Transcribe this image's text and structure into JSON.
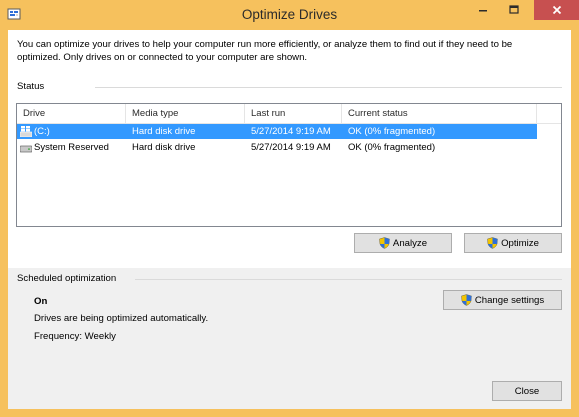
{
  "window": {
    "title": "Optimize Drives"
  },
  "intro": {
    "text": "You can optimize your drives to help your computer run more efficiently, or analyze them to find out if they need to be optimized. Only drives on or connected to your computer are shown."
  },
  "status": {
    "label": "Status",
    "columns": [
      "Drive",
      "Media type",
      "Last run",
      "Current status"
    ],
    "rows": [
      {
        "drive": "(C:)",
        "media_type": "Hard disk drive",
        "last_run": "5/27/2014 9:19 AM",
        "current_status": "OK (0% fragmented)",
        "selected": true
      },
      {
        "drive": "System Reserved",
        "media_type": "Hard disk drive",
        "last_run": "5/27/2014 9:19 AM",
        "current_status": "OK (0% fragmented)",
        "selected": false
      }
    ]
  },
  "buttons": {
    "analyze": "Analyze",
    "optimize": "Optimize",
    "change_settings": "Change settings",
    "close": "Close"
  },
  "scheduled": {
    "label": "Scheduled optimization",
    "state": "On",
    "description": "Drives are being optimized automatically.",
    "frequency": "Frequency: Weekly"
  },
  "colors": {
    "frame": "#f6c15d",
    "selection": "#3399ff",
    "close_button": "#c75050"
  },
  "icons": {
    "app": "defrag-icon",
    "drive_c": "windows-drive-icon",
    "drive_system_reserved": "hard-drive-icon",
    "button_shield": "uac-shield-icon"
  }
}
